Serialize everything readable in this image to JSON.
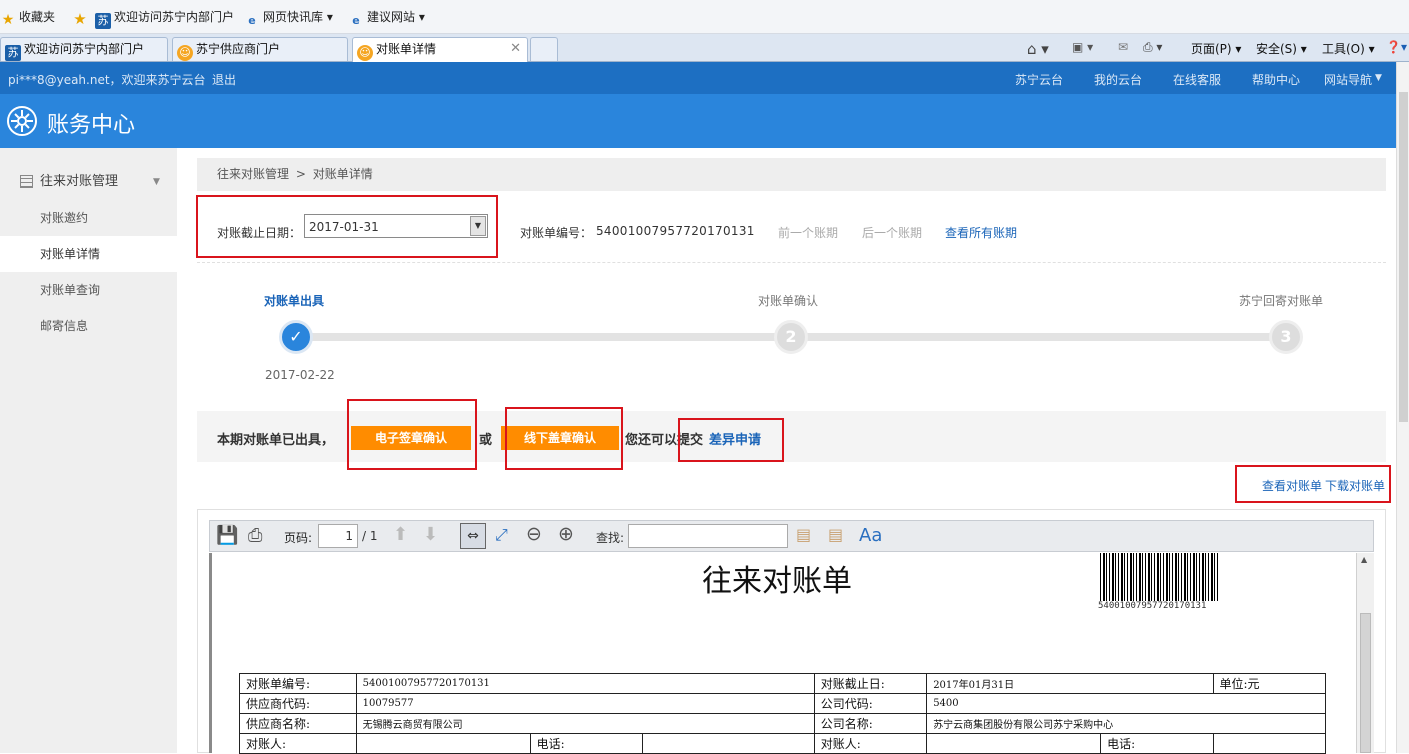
{
  "browser": {
    "favorites": "收藏夹",
    "fav_links": [
      "欢迎访问苏宁内部门户",
      "网页快讯库 ▾",
      "建议网站 ▾"
    ],
    "tabs": [
      "欢迎访问苏宁内部门户",
      "苏宁供应商门户",
      "对账单详情"
    ],
    "tools": {
      "page": "页面(P) ▾",
      "safety": "安全(S) ▾",
      "tools": "工具(O) ▾"
    }
  },
  "topbar": {
    "user": "pi***8@yeah.net，欢迎来苏宁云台",
    "logout": "退出",
    "links": [
      "苏宁云台",
      "我的云台",
      "在线客服",
      "帮助中心",
      "网站导航"
    ]
  },
  "header": {
    "title": "账务中心"
  },
  "sidebar": {
    "group": "往来对账管理",
    "items": [
      "对账邀约",
      "对账单详情",
      "对账单查询",
      "邮寄信息"
    ]
  },
  "breadcrumb": {
    "root": "往来对账管理",
    "sep": ">",
    "current": "对账单详情"
  },
  "filter": {
    "date_label": "对账截止日期：",
    "date_value": "2017-01-31",
    "no_label": "对账单编号：",
    "no_value": "54001007957720170131",
    "prev": "前一个账期",
    "next": "后一个账期",
    "all": "查看所有账期"
  },
  "steps": [
    {
      "label": "对账单出具",
      "num": "1",
      "date": "2017-02-22",
      "done": true
    },
    {
      "label": "对账单确认",
      "num": "2"
    },
    {
      "label": "苏宁回寄对账单",
      "num": "3"
    }
  ],
  "action": {
    "text": "本期对账单已出具，",
    "btn_esign": "电子签章确认",
    "or": "或",
    "btn_offline": "线下盖章确认",
    "hint": "您还可以提交",
    "diff": "差异申请"
  },
  "doc_links": {
    "view": "查看对账单",
    "download": "下载对账单"
  },
  "pdf": {
    "page_label": "页码:",
    "page_value": "1",
    "page_total": "/ 1",
    "find_label": "查找:",
    "aa": "Aa",
    "title": "往来对账单",
    "barcode_text": "54001007957720170131",
    "rows": [
      [
        "对账单编号:",
        "54001007957720170131",
        "对账截止日:",
        "2017年01月31日",
        "单位:元"
      ],
      [
        "供应商代码:",
        "10079577",
        "公司代码:",
        "5400"
      ],
      [
        "供应商名称:",
        "无锡腾云商贸有限公司",
        "公司名称:",
        "苏宁云商集团股份有限公司苏宁采购中心"
      ],
      [
        "对账人:",
        "",
        "电话:",
        "",
        "对账人:",
        "",
        "电话:",
        ""
      ]
    ]
  },
  "colors": {
    "brand": "#2a85dc",
    "topbar": "#1d6fc2",
    "accent": "#ff8c00",
    "highlight": "#d9141c"
  }
}
